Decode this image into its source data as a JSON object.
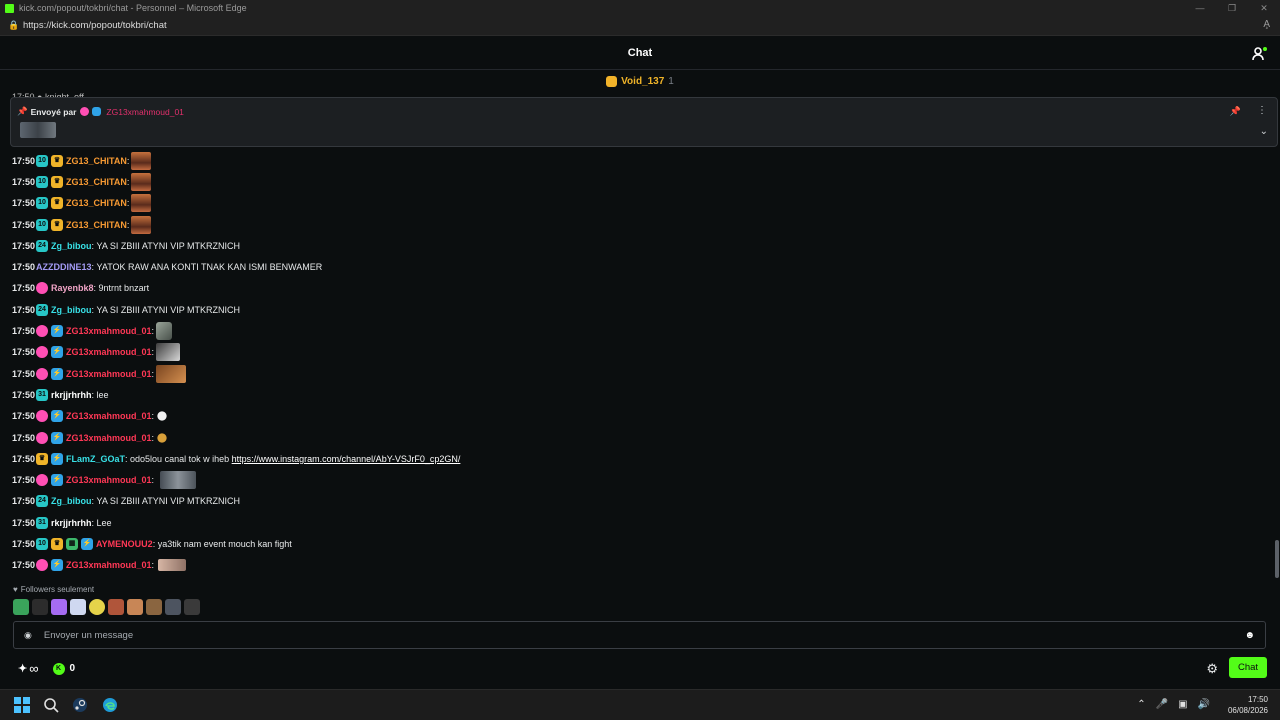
{
  "window": {
    "title": "kick.com/popout/tokbri/chat - Personnel – Microsoft Edge",
    "url": "https://kick.com/popout/tokbri/chat",
    "reader_label": "A̧"
  },
  "header": {
    "title": "Chat"
  },
  "gifter": {
    "name": "Void_137",
    "count": "1"
  },
  "pinned": {
    "label": "Envoyé par",
    "sender": "ZG13xmahmoud_01"
  },
  "messages": [
    {
      "time": "17:50",
      "user": "ZG13_CHITAN",
      "text": "",
      "color": "#f79a33"
    },
    {
      "time": "17:50",
      "user": "ZG13_CHITAN",
      "text": "",
      "color": "#f79a33"
    },
    {
      "time": "17:50",
      "user": "ZG13_CHITAN",
      "text": "",
      "color": "#f79a33"
    },
    {
      "time": "17:50",
      "user": "ZG13_CHITAN",
      "text": "",
      "color": "#f79a33"
    },
    {
      "time": "17:50",
      "user": "Zg_bibou",
      "text": "YA SI ZBIII ATYNI VIP MTKRZNICH",
      "color": "#38e0e6"
    },
    {
      "time": "17:50",
      "user": "AZZDDINE13",
      "text": "YATOK RAW ANA KONTI TNAK KAN ISMI BENWAMER",
      "color": "#a49bf5"
    },
    {
      "time": "17:50",
      "user": "Rayenbk8",
      "text": "9ntrnt bnzart",
      "color": "#f0a4c6"
    },
    {
      "time": "17:50",
      "user": "Zg_bibou",
      "text": "YA SI ZBIII ATYNI VIP MTKRZNICH",
      "color": "#38e0e6"
    },
    {
      "time": "17:50",
      "user": "ZG13xmahmoud_01",
      "text": "",
      "color": "#ff3856"
    },
    {
      "time": "17:50",
      "user": "ZG13xmahmoud_01",
      "text": "",
      "color": "#ff3856"
    },
    {
      "time": "17:50",
      "user": "ZG13xmahmoud_01",
      "text": "",
      "color": "#ff3856"
    },
    {
      "time": "17:50",
      "user": "rkrjjrhrhh",
      "text": "lee",
      "color": "#ffffff"
    },
    {
      "time": "17:50",
      "user": "ZG13xmahmoud_01",
      "text": "",
      "color": "#ff3856"
    },
    {
      "time": "17:50",
      "user": "ZG13xmahmoud_01",
      "text": "",
      "color": "#ff3856"
    },
    {
      "time": "17:50",
      "user": "FLamZ_GOaT",
      "text": "odo5lou canal tok w iheb",
      "link": "https://www.instagram.com/channel/AbY-VSJrF0_cp2GN/",
      "color": "#38e0e6"
    },
    {
      "time": "17:50",
      "user": "ZG13xmahmoud_01",
      "text": "",
      "color": "#ff3856"
    },
    {
      "time": "17:50",
      "user": "Zg_bibou",
      "text": "YA SI ZBIII ATYNI VIP MTKRZNICH",
      "color": "#38e0e6"
    },
    {
      "time": "17:50",
      "user": "rkrjjrhrhh",
      "text": "Lee",
      "color": "#ffffff"
    },
    {
      "time": "17:50",
      "user": "AYMENOUU2",
      "text": "ya3tik nam event mouch kan fight",
      "color": "#ff3856"
    },
    {
      "time": "17:50",
      "user": "ZG13xmahmoud_01",
      "text": "",
      "color": "#ff3856"
    }
  ],
  "followers_only": "Followers seulement",
  "input": {
    "placeholder": "Envoyer un message"
  },
  "footer": {
    "infinity": "∞",
    "points": "0",
    "send_label": "Chat"
  },
  "taskbar": {
    "time": "17:50",
    "date": "06/08/2026"
  }
}
